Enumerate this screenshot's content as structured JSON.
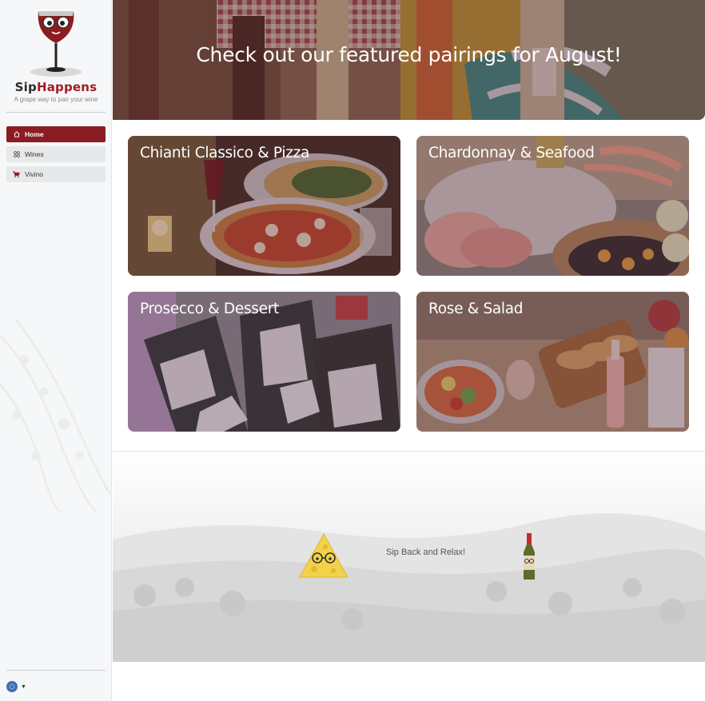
{
  "app": {
    "brand_sip": "Sip",
    "brand_happens": "Happens",
    "tagline": "A grape way to pair your wine"
  },
  "sidebar": {
    "items": [
      {
        "label": "Home",
        "icon": "home-icon",
        "active": true
      },
      {
        "label": "Wines",
        "icon": "grid-icon",
        "active": false
      },
      {
        "label": "Vivino",
        "icon": "cart-icon",
        "active": false
      }
    ]
  },
  "hero": {
    "title": "Check out our featured pairings for August!"
  },
  "pairings": [
    {
      "title": "Chianti Classico & Pizza"
    },
    {
      "title": "Chardonnay & Seafood"
    },
    {
      "title": "Prosecco & Dessert"
    },
    {
      "title": "Rose & Salad"
    }
  ],
  "footer": {
    "text": "Sip Back and Relax!"
  },
  "colors": {
    "accent": "#8b1d22",
    "brand_red": "#a11d22",
    "overlay": "#5a2a3a"
  }
}
